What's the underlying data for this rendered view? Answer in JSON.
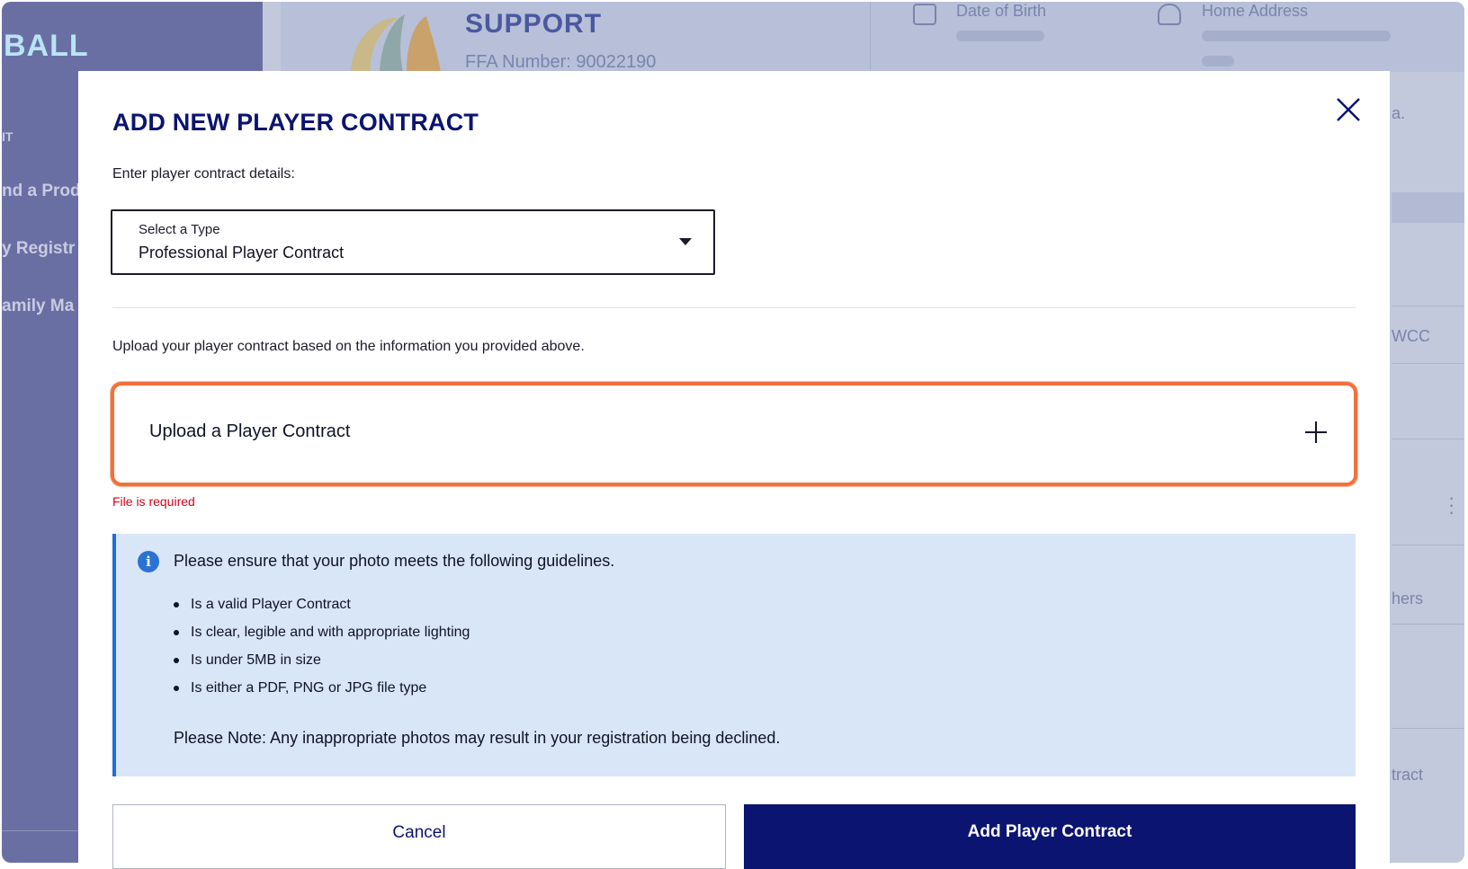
{
  "background": {
    "brand": "BALL",
    "nav_items": [
      "IT",
      "nd a Prod",
      "y Registr",
      "amily Ma"
    ],
    "org_name": "SUPPORT",
    "ffa_number": "FFA Number: 90022190",
    "date_of_birth_label": "Date of Birth",
    "home_address_label": "Home Address",
    "right_snippets": [
      "a.",
      "WCC",
      "hers",
      "tract"
    ]
  },
  "modal": {
    "title": "ADD NEW PLAYER CONTRACT",
    "subtitle": "Enter player contract details:",
    "select": {
      "label": "Select a Type",
      "value": "Professional Player Contract"
    },
    "upload_description": "Upload your player contract based on the information you provided above.",
    "upload_label": "Upload a Player Contract",
    "error": "File is required",
    "guidelines": {
      "heading": "Please ensure that your photo meets the following guidelines.",
      "items": [
        "Is a valid Player Contract",
        "Is clear, legible and with appropriate lighting",
        "Is under 5MB in size",
        "Is either a PDF, PNG or JPG file type"
      ],
      "note": "Please Note: Any inappropriate photos may result in your registration being declined."
    },
    "cancel_label": "Cancel",
    "submit_label": "Add Player Contract"
  },
  "colors": {
    "navy": "#0b1470",
    "highlight": "#f2703c",
    "error": "#d0021b",
    "info_bg": "#d9e6f7",
    "info_accent": "#1e6fd9"
  }
}
